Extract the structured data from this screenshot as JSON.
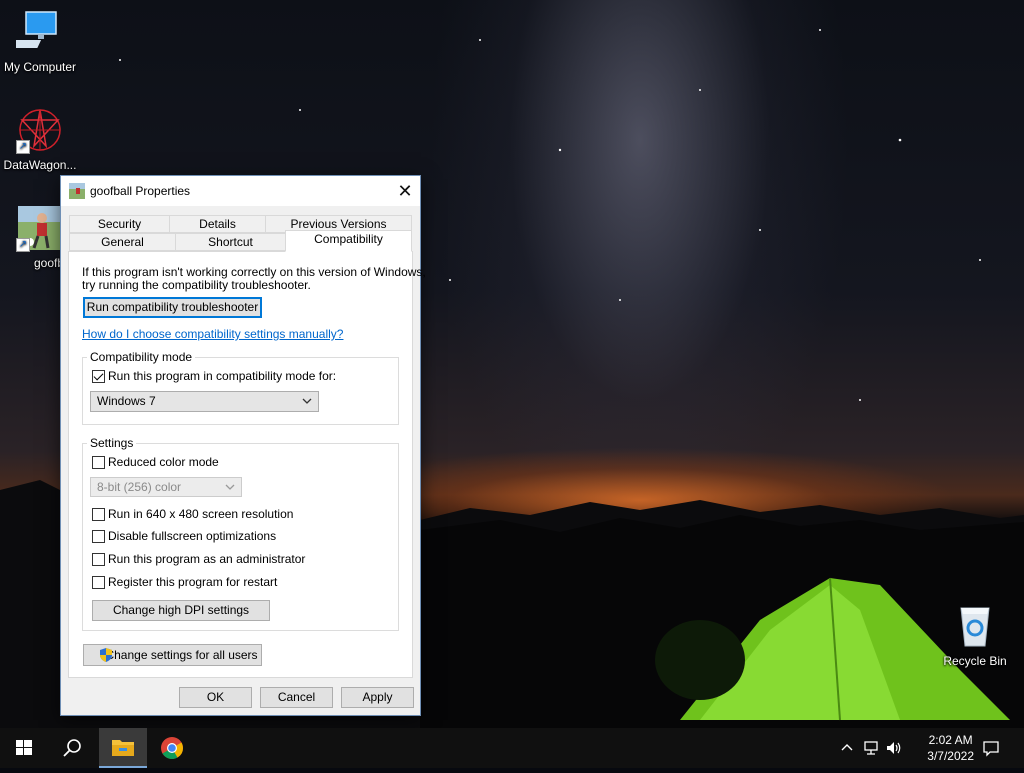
{
  "desktop": {
    "icons": [
      {
        "label": "My Computer",
        "icon": "monitor-icon"
      },
      {
        "label": "DataWagon...",
        "icon": "star-logo-icon"
      },
      {
        "label": "goofball",
        "icon": "goofball-icon"
      },
      {
        "label": "Recycle Bin",
        "icon": "recycle-bin-icon"
      }
    ]
  },
  "dialog": {
    "title": "goofball Properties",
    "tabs_row1": [
      "Security",
      "Details",
      "Previous Versions"
    ],
    "tabs_row2": [
      "General",
      "Shortcut",
      "Compatibility"
    ],
    "active_tab": "Compatibility",
    "intro_line1": "If this program isn't working correctly on this version of Windows,",
    "intro_line2": "try running the compatibility troubleshooter.",
    "troubleshooter_button": "Run compatibility troubleshooter",
    "help_link": "How do I choose compatibility settings manually?",
    "compat_mode": {
      "group_label": "Compatibility mode",
      "checkbox_label": "Run this program in compatibility mode for:",
      "checked": true,
      "selected_os": "Windows 7"
    },
    "settings": {
      "group_label": "Settings",
      "reduced_color": "Reduced color mode",
      "color_select": "8-bit (256) color",
      "resolution_640": "Run in 640 x 480 screen resolution",
      "disable_fullscreen": "Disable fullscreen optimizations",
      "run_as_admin": "Run this program as an administrator",
      "register_restart": "Register this program for restart",
      "dpi_button": "Change high DPI settings"
    },
    "all_users_button": "Change settings for all users",
    "ok_button": "OK",
    "cancel_button": "Cancel",
    "apply_button": "Apply"
  },
  "taskbar": {
    "time": "2:02 AM",
    "date": "3/7/2022"
  },
  "colors": {
    "accent": "#0078d7",
    "link": "#0066cc",
    "tent": "#7ed321"
  }
}
